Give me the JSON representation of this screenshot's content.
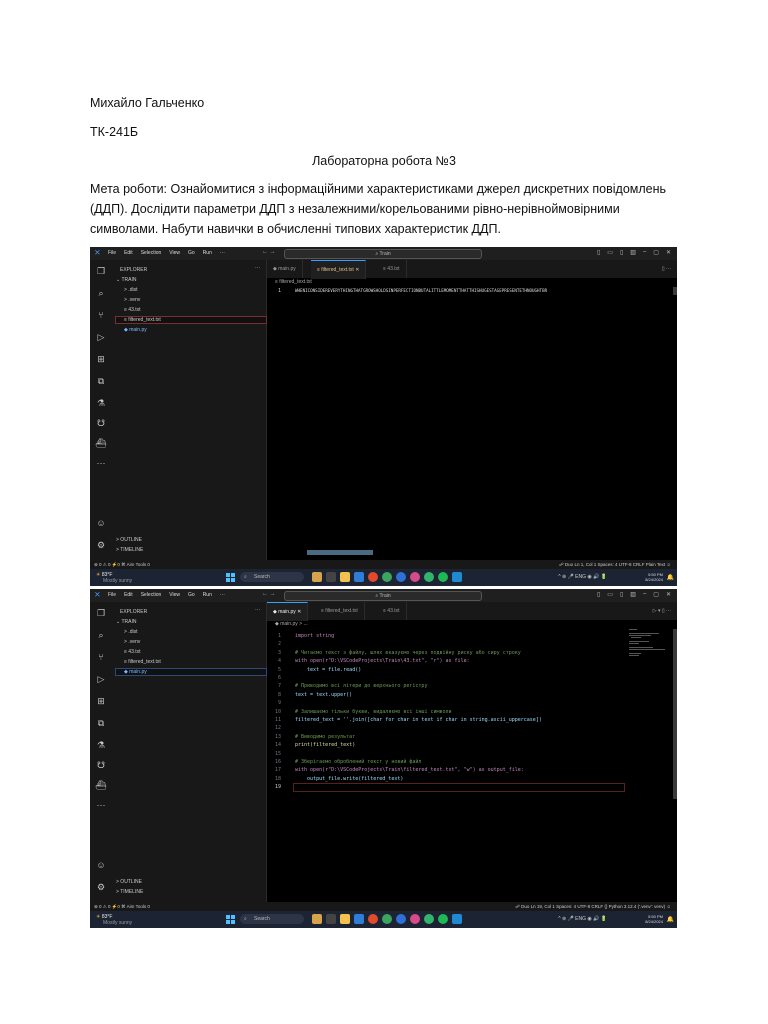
{
  "document": {
    "author": "Михайло Гальченко",
    "group": "ТК-241Б",
    "title": "Лабораторна робота №3",
    "purpose": "Мета роботи: Ознайомитися з інформаційними характеристиками джерел дискретних повідомлень (ДДП). Дослідити параметри ДДП з незалежними/корельованими рівно-нерівноймовірними символами. Набути навички в обчисленні типових характеристик ДДП."
  },
  "vscode": {
    "menu": [
      "File",
      "Edit",
      "Selection",
      "View",
      "Go",
      "Run",
      "···"
    ],
    "nav_arrows": "← →",
    "search_placeholder": "Train",
    "window_controls": [
      "▯",
      "▭",
      "▯",
      "▥",
      "–",
      "▢",
      "✕"
    ],
    "explorer_label": "EXPLORER",
    "explorer_more": "···",
    "folder": "TRAIN",
    "files": [
      "> .dist",
      "> .venv",
      "≡ 43.txt",
      "≡ filtered_text.txt",
      "◆ main.py"
    ],
    "outline": "> OUTLINE",
    "timeline": "> TIMELINE",
    "status_left": "⊗ 0 ⚠ 0   ⚡0   ⌘ Aim Tools 0",
    "taskbar": {
      "weather_temp": "83°F",
      "weather_desc": "Mostly sunny",
      "search": "Search",
      "tray": "^  ⊛  🎤  ENG  ◉  🔊  🔋",
      "time": "5:50 PM",
      "date": "8/24/2024",
      "bell": "🔔"
    }
  },
  "shot1": {
    "tabs": [
      "◆ main.py",
      "≡ filtered_text.txt ✕",
      "≡ 43.txt"
    ],
    "tab_right": "▯  ···",
    "breadcrumb": "≡ filtered_text.txt",
    "line_numbers": [
      "1"
    ],
    "code_line": "WHENICONSIDEREVERYTHINGTHATGROWSHOLDSINPERFECTIONBUTALITTLEMOMENTTHATTHISHUGESTAGEPRESENTETHNOUGHTBR",
    "status_right": "☍ Duo   Ln 1, Col 1   Spaces: 4   UTF-8   CRLF   Plain Text   ☺"
  },
  "shot2": {
    "tabs": [
      "◆ main.py ✕",
      "≡ filtered_text.txt",
      "≡ 43.txt"
    ],
    "tab_right": "▷ ▾  ▯  ···",
    "breadcrumb": "◆ main.py > ...",
    "line_numbers": [
      "1",
      "2",
      "3",
      "4",
      "5",
      "6",
      "7",
      "8",
      "9",
      "10",
      "11",
      "12",
      "13",
      "14",
      "15",
      "16",
      "17",
      "18",
      "19"
    ],
    "code": [
      "import string",
      "",
      "# Читаємо текст з файлу, шлях вказуємо через подвійну риску або сиру строку",
      "with open(r\"D:\\VSCodeProjects\\Train\\43.txt\", \"r\") as file:",
      "    text = file.read()",
      "",
      "# Приводимо всі літери до верхнього регістру",
      "text = text.upper()",
      "",
      "# Залишаємо тільки букви, видаляємо всі інші символи",
      "filtered_text = ''.join([char for char in text if char in string.ascii_uppercase])",
      "",
      "# Виводимо результат",
      "print(filtered_text)",
      "",
      "# Зберігаємо оброблений текст у новий файл",
      "with open(r\"D:\\VSCodeProjects\\Train\\filtered_text.txt\", \"w\") as output_file:",
      "    output_file.write(filtered_text)",
      ""
    ],
    "status_right": "☍ Duo   Ln 19, Col 1   Spaces: 4   UTF-8   CRLF   {} Python   3.12.4 ('.venv': venv)   ☺"
  },
  "colors": {
    "keyword": "#c586c0",
    "comment": "#6a9955",
    "string": "#ce9178",
    "function": "#dcdcaa",
    "variable": "#9cdcfe",
    "accent": "#3aa0ff"
  },
  "icons": [
    "vscode-icon",
    "files-icon",
    "search-icon",
    "source-control-icon",
    "run-debug-icon",
    "extensions-icon",
    "remote-icon",
    "testing-icon",
    "copilot-icon",
    "docker-icon",
    "more-icon",
    "account-icon",
    "settings-icon"
  ]
}
